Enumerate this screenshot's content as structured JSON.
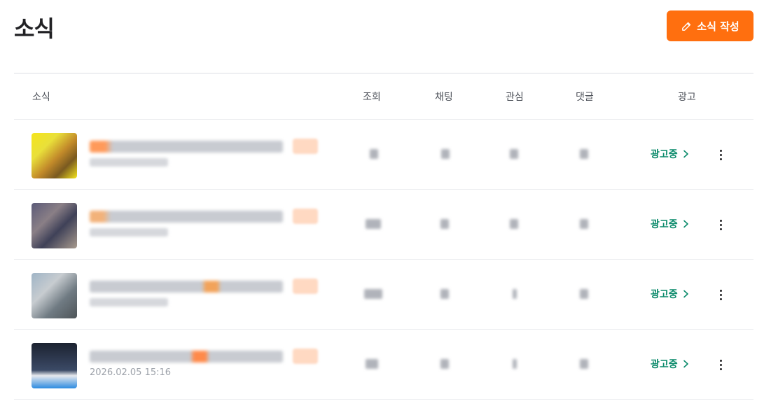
{
  "page": {
    "title": "소식"
  },
  "toolbar": {
    "write_label": "소식 작성",
    "write_icon": "pencil-icon"
  },
  "table": {
    "headers": {
      "news": "소식",
      "views": "조회",
      "chat": "채팅",
      "interest": "관심",
      "comment": "댓글",
      "ad": "광고"
    },
    "rows": [
      {
        "thumb_colors": [
          "#f5e51c",
          "#c28a2a",
          "#7a5a20",
          "#e9e03a"
        ],
        "date": "",
        "ad_status": "광고중"
      },
      {
        "thumb_colors": [
          "#5b5a78",
          "#8a7f86",
          "#3f4158",
          "#a89b8e"
        ],
        "date": "",
        "ad_status": "광고중"
      },
      {
        "thumb_colors": [
          "#9fb4c6",
          "#6f7a82",
          "#c7ccd0",
          "#4e5458"
        ],
        "date": "",
        "ad_status": "광고중"
      },
      {
        "thumb_colors": [
          "#1c2230",
          "#3b4a66",
          "#2d8be0",
          "#e7e9ee"
        ],
        "date": "2026.02.05 15:16",
        "ad_status": "광고중"
      }
    ]
  },
  "colors": {
    "accent": "#ff6f0f",
    "ad_green": "#0a8a6a"
  }
}
